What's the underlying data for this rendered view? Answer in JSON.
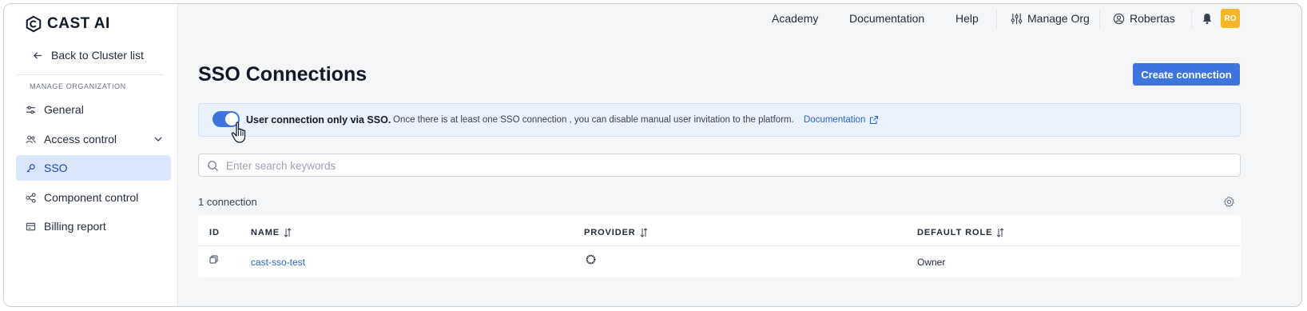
{
  "brand": {
    "name": "CAST AI"
  },
  "sidebar": {
    "back_label": "Back to Cluster list",
    "section_label": "MANAGE ORGANIZATION",
    "items": [
      {
        "label": "General",
        "icon": "sliders-icon"
      },
      {
        "label": "Access control",
        "icon": "users-icon"
      },
      {
        "label": "SSO",
        "icon": "key-icon",
        "active": true
      },
      {
        "label": "Component control",
        "icon": "components-icon"
      },
      {
        "label": "Billing report",
        "icon": "billing-icon"
      }
    ]
  },
  "topbar": {
    "academy": "Academy",
    "documentation": "Documentation",
    "help": "Help",
    "manage_org": "Manage Org",
    "user": "Robertas",
    "avatar_initials": "RO"
  },
  "main": {
    "title": "SSO Connections",
    "create_button": "Create connection",
    "banner": {
      "toggle_on": true,
      "strong": "User connection only via SSO.",
      "text": "Once there is at least one SSO connection , you can disable manual user invitation to the platform.",
      "link": "Documentation"
    },
    "search": {
      "placeholder": "Enter search keywords",
      "value": ""
    },
    "count_label": "1 connection",
    "table": {
      "headers": {
        "id": "ID",
        "name": "NAME",
        "provider": "PROVIDER",
        "default_role": "DEFAULT ROLE"
      },
      "rows": [
        {
          "name": "cast-sso-test",
          "provider_icon": "okta-icon",
          "default_role": "Owner"
        }
      ]
    }
  },
  "colors": {
    "accent": "#3d74dd",
    "active_nav_bg": "#d9e6fb",
    "banner_bg": "#eaf2fd",
    "avatar_bg": "#f4b628"
  }
}
